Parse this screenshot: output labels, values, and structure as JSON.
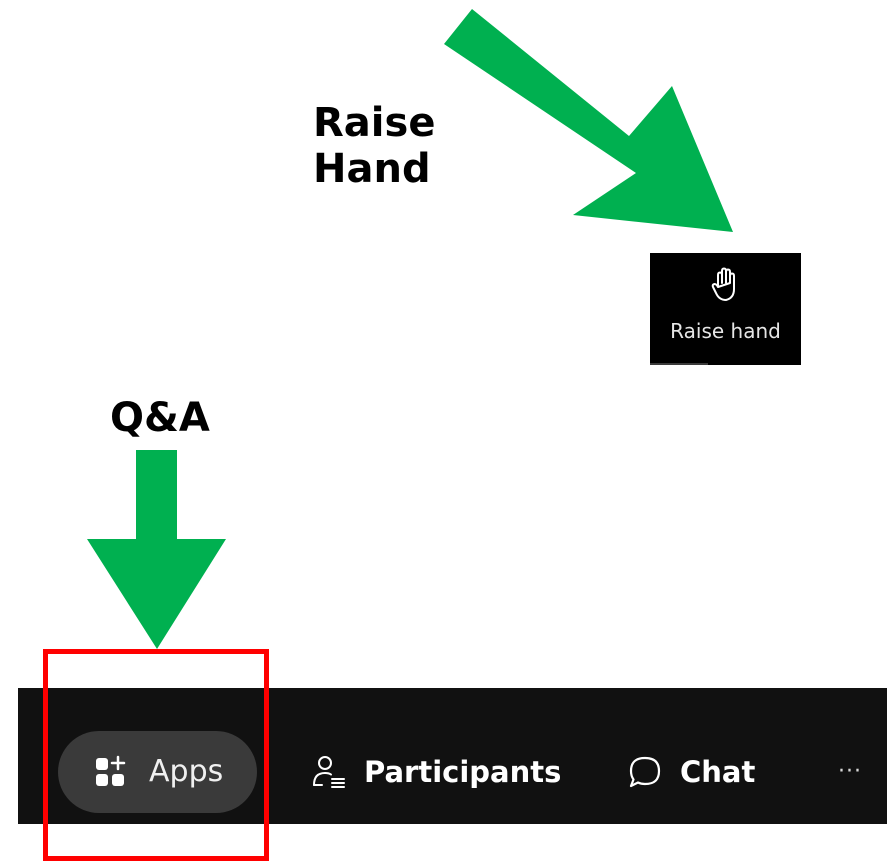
{
  "annotations": {
    "raise_hand_label": "Raise Hand",
    "qa_label": "Q&A",
    "arrow_color": "#00b050",
    "highlight_color": "#ff0000"
  },
  "raise_hand_tile": {
    "icon": "raised-hand-icon",
    "label": "Raise hand"
  },
  "toolbar": {
    "apps": {
      "icon": "apps-grid-plus-icon",
      "label": "Apps"
    },
    "participants": {
      "icon": "participants-icon",
      "label": "Participants"
    },
    "chat": {
      "icon": "chat-bubble-icon",
      "label": "Chat"
    },
    "more": {
      "icon": "more-horizontal-icon",
      "label": "···"
    }
  }
}
